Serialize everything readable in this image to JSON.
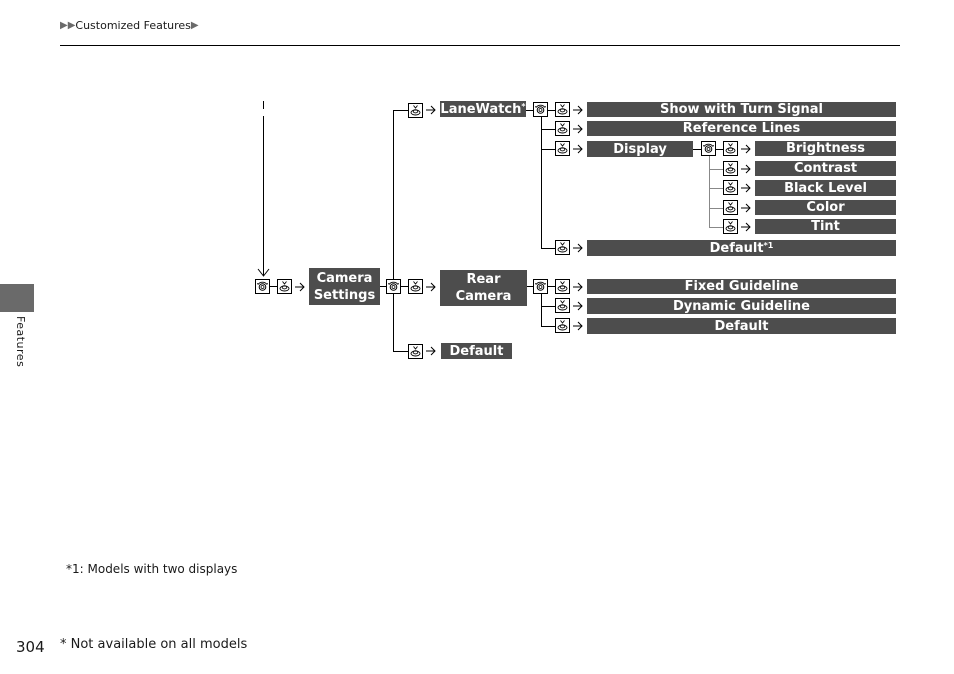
{
  "header": {
    "breadcrumb": "Customized Features",
    "breadcrumb_prefix_icon": "double-triangle-right-icon",
    "breadcrumb_suffix_icon": "triangle-right-icon"
  },
  "sidebar": {
    "tab_label": "Features"
  },
  "diagram": {
    "root": {
      "label_line1": "Camera",
      "label_line2": "Settings"
    },
    "lanewatch": {
      "label": "LaneWatch",
      "marker": "*"
    },
    "lanewatch_items": [
      {
        "label": "Show with Turn Signal"
      },
      {
        "label": "Reference Lines"
      },
      {
        "label": "Display"
      }
    ],
    "display_items": [
      {
        "label": "Brightness"
      },
      {
        "label": "Contrast"
      },
      {
        "label": "Black Level"
      },
      {
        "label": "Color"
      },
      {
        "label": "Tint"
      }
    ],
    "lanewatch_default": {
      "label": "Default",
      "marker": "*1"
    },
    "rear_camera": {
      "label_line1": "Rear",
      "label_line2": "Camera"
    },
    "rear_items": [
      {
        "label": "Fixed Guideline"
      },
      {
        "label": "Dynamic Guideline"
      },
      {
        "label": "Default"
      }
    ],
    "camera_default": {
      "label": "Default"
    },
    "icons": {
      "dial": "selector-dial-icon",
      "press": "press-knob-icon",
      "arrow": "arrow-right-icon"
    }
  },
  "footnotes": {
    "note1": "*1: Models with two displays",
    "note_star": "* Not available on all models"
  },
  "page_number": "304",
  "colors": {
    "box_fill": "#4d4d4d",
    "box_text": "#ffffff",
    "side_tab": "#6a6a6a"
  }
}
